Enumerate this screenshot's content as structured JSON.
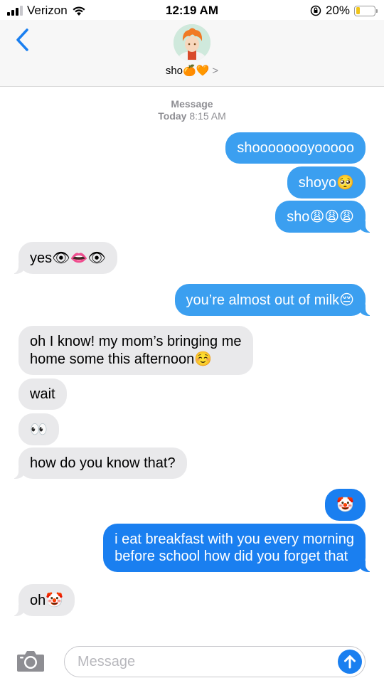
{
  "status_bar": {
    "carrier": "Verizon",
    "time": "12:19 AM",
    "battery_percent": "20%",
    "battery_level": 0.2
  },
  "header": {
    "back_label": "<",
    "contact_name": "sho",
    "contact_emoji": "🍊🧡",
    "chevron": ">"
  },
  "thread": {
    "label": "Message",
    "date": "Today",
    "time": "8:15 AM"
  },
  "messages": [
    {
      "from": "me",
      "text": "shoooooooyooooo"
    },
    {
      "from": "me",
      "text": "shoyo",
      "emoji": "🥺"
    },
    {
      "from": "me",
      "text": "sho",
      "emoji": "😩😩😩"
    },
    {
      "from": "them",
      "text": "yes",
      "emoji": "👁👄👁"
    },
    {
      "from": "me",
      "text": "you’re almost out of milk",
      "emoji": "😔"
    },
    {
      "from": "them",
      "line1": "oh I know! my mom’s bringing me",
      "line2": "home some this afternoon",
      "emoji": "☺️"
    },
    {
      "from": "them",
      "text": "wait"
    },
    {
      "from": "them",
      "emoji": "👀"
    },
    {
      "from": "them",
      "text": "how do you know that?"
    },
    {
      "from": "me",
      "emoji": "🤡"
    },
    {
      "from": "me",
      "line1": "i eat breakfast with you every morning",
      "line2": "before school how did you forget that"
    },
    {
      "from": "them",
      "text": "oh",
      "emoji": "🤡"
    }
  ],
  "input": {
    "placeholder": "Message"
  },
  "colors": {
    "sent_bubble": "#3b9ff0",
    "sent_bubble_dark": "#1a7ff0",
    "received_bubble": "#e9e9eb",
    "accent": "#1a7ff0",
    "battery_low": "#f0c419"
  },
  "icons": [
    "signal-icon",
    "wifi-icon",
    "orientation-lock-icon",
    "battery-icon",
    "back-chevron-icon",
    "camera-icon",
    "send-arrow-icon"
  ]
}
